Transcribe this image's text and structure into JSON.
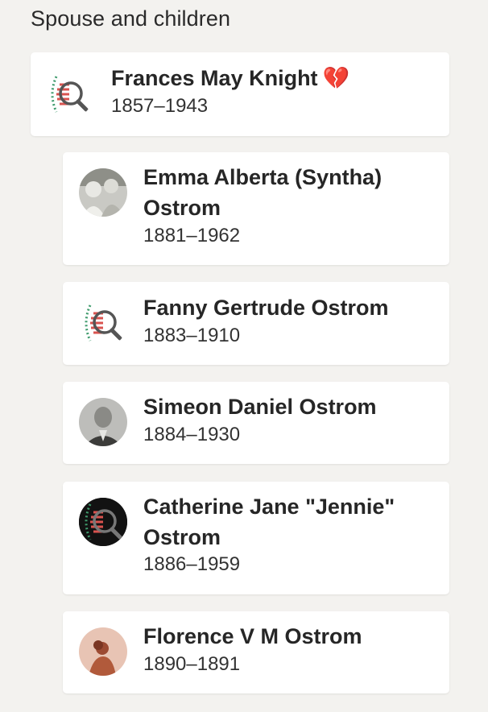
{
  "section": {
    "title": "Spouse and children"
  },
  "spouse": {
    "name": "Frances May Knight",
    "status_icon": "💔",
    "dates": "1857–1943",
    "avatar": "dna-search-placeholder"
  },
  "children": [
    {
      "name_line1": "Emma Alberta (Syntha)",
      "name_line2": "Ostrom",
      "dates": "1881–1962",
      "avatar": "photo-elderly-couple"
    },
    {
      "name_line1": "Fanny Gertrude Ostrom",
      "name_line2": "",
      "dates": "1883–1910",
      "avatar": "dna-search-placeholder"
    },
    {
      "name_line1": "Simeon Daniel Ostrom",
      "name_line2": "",
      "dates": "1884–1930",
      "avatar": "photo-man-suit"
    },
    {
      "name_line1": "Catherine Jane \"Jennie\"",
      "name_line2": "Ostrom",
      "dates": "1886–1959",
      "avatar": "dna-search-placeholder-dark"
    },
    {
      "name_line1": "Florence V M Ostrom",
      "name_line2": "",
      "dates": "1890–1891",
      "avatar": "woman-silhouette"
    }
  ]
}
